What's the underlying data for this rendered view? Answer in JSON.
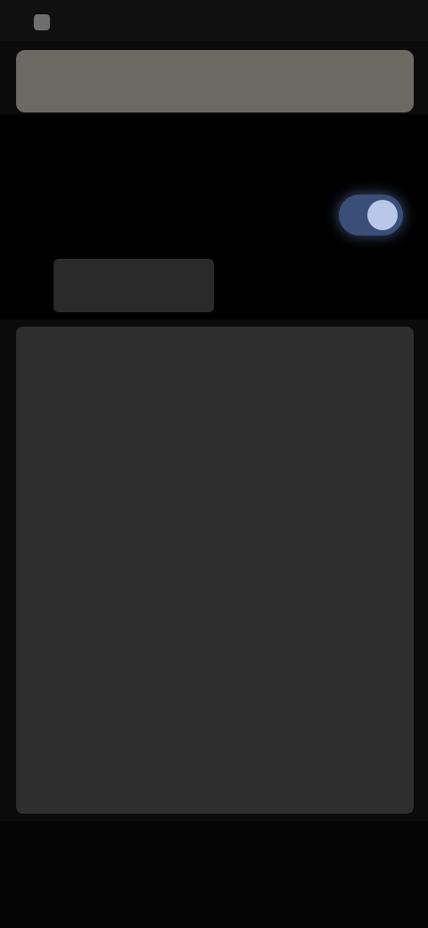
{
  "status_bar": {
    "text": ""
  },
  "search": {
    "value": "",
    "placeholder": ""
  },
  "header": {
    "title": ""
  },
  "setting": {
    "label": "",
    "toggle_on": true
  },
  "tabs": [
    {
      "label": ""
    },
    {
      "label": ""
    }
  ],
  "list": {
    "items": [
      {
        "label": "",
        "value": ""
      },
      {
        "label": "",
        "value": ""
      },
      {
        "label": "",
        "value": ""
      },
      {
        "label": "",
        "value": ""
      },
      {
        "label": "",
        "value": ""
      },
      {
        "label": "",
        "value": ""
      },
      {
        "label": "",
        "value": ""
      },
      {
        "label": "",
        "value": ""
      }
    ]
  },
  "colors": {
    "accent": "#3b4e78",
    "panel": "#2e2e2e",
    "background": "#0b0b0b"
  }
}
